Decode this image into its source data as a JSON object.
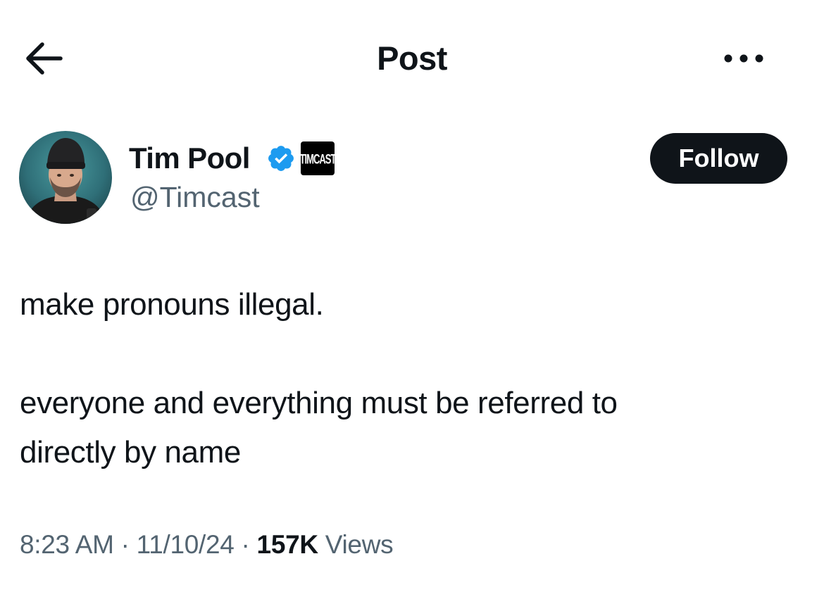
{
  "header": {
    "title": "Post",
    "back_icon": "arrow-left-icon",
    "more_icon": "more-horizontal-icon"
  },
  "author": {
    "name": "Tim Pool",
    "handle": "@Timcast",
    "verified_icon": "verified-badge-icon",
    "affiliate_label": "TIMCAST",
    "follow_label": "Follow"
  },
  "tweet": {
    "lines": [
      "make pronouns illegal.",
      "",
      "everyone and everything must be referred to",
      "directly by name"
    ]
  },
  "meta": {
    "time": "8:23 AM",
    "separator": "·",
    "date": "11/10/24",
    "views_count": "157K",
    "views_label": "Views"
  },
  "colors": {
    "text_primary": "#0f1419",
    "text_secondary": "#536471",
    "verified_blue": "#1d9bf0",
    "follow_bg": "#0f1419"
  }
}
